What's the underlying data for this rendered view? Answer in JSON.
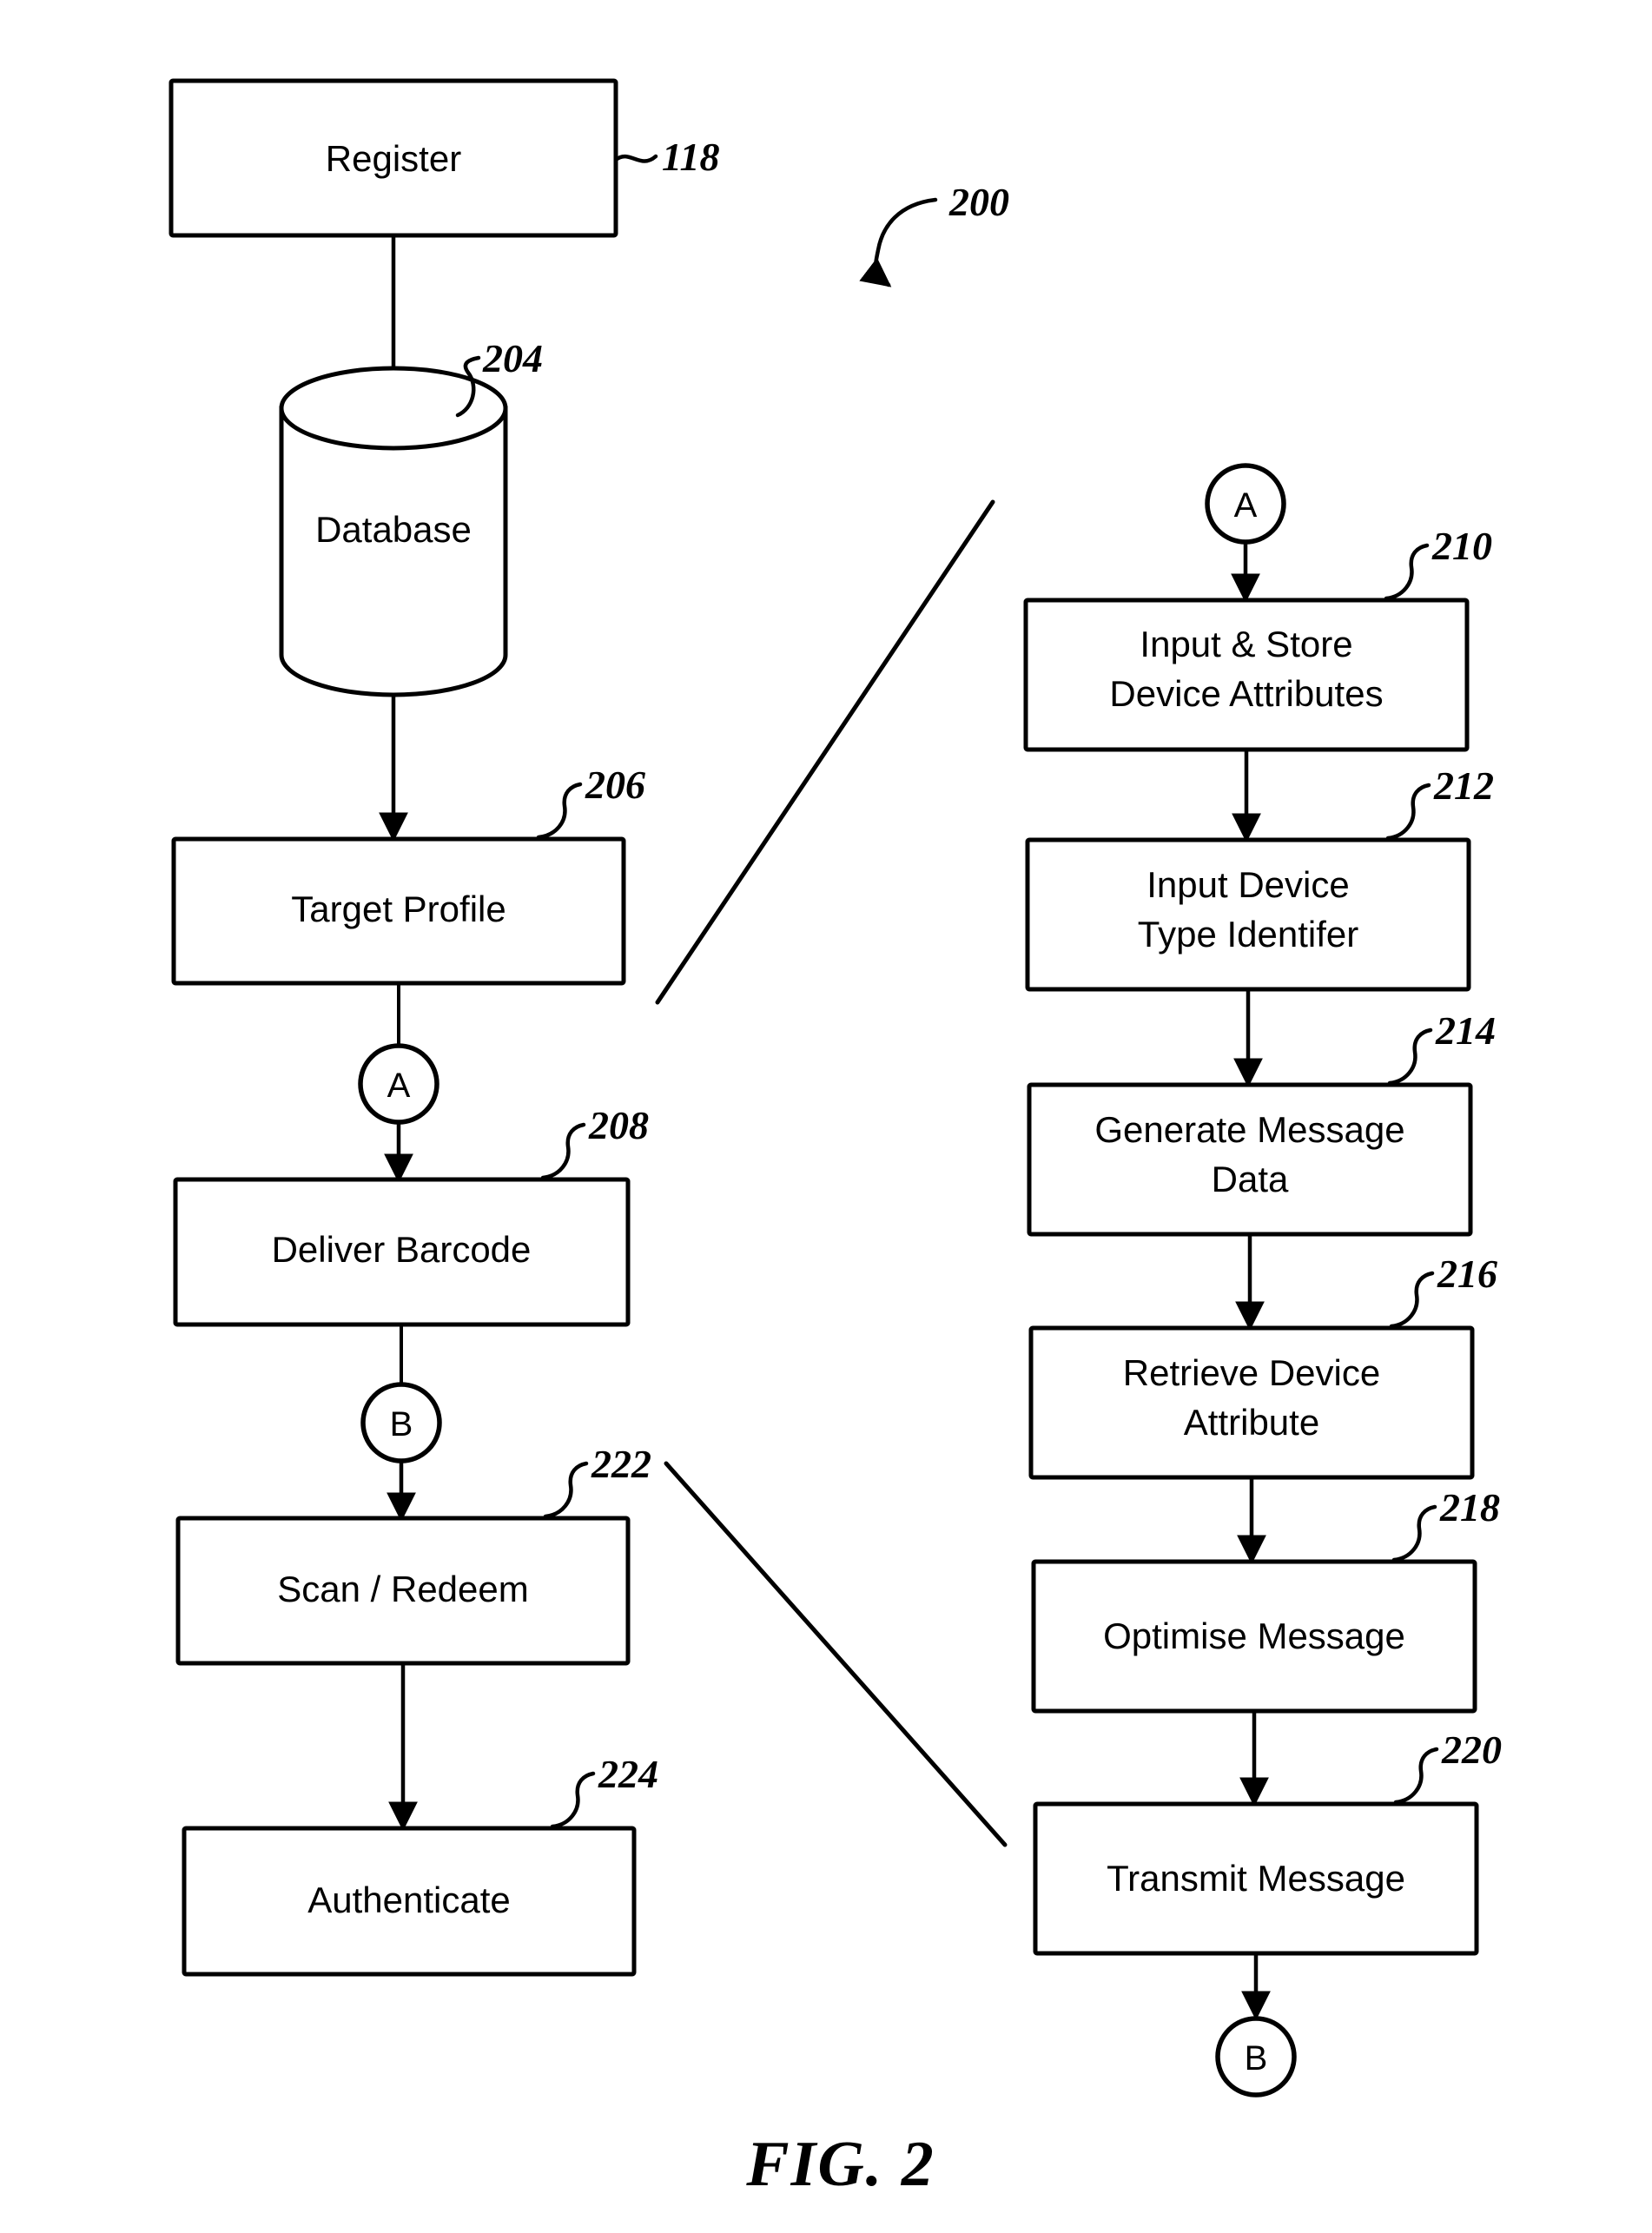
{
  "figure": {
    "caption": "FIG. 2",
    "overall_ref": "200"
  },
  "left_column": {
    "nodes": [
      {
        "id": "register",
        "label": "Register",
        "ref": "118",
        "shape": "rect"
      },
      {
        "id": "database",
        "label": "Database",
        "ref": "204",
        "shape": "cylinder"
      },
      {
        "id": "target_profile",
        "label": "Target Profile",
        "ref": "206",
        "shape": "rect"
      },
      {
        "id": "deliver_barcode",
        "label": "Deliver Barcode",
        "ref": "208",
        "shape": "rect"
      },
      {
        "id": "scan_redeem",
        "label": "Scan / Redeem",
        "ref": "222",
        "shape": "rect"
      },
      {
        "id": "authenticate",
        "label": "Authenticate",
        "ref": "224",
        "shape": "rect"
      }
    ],
    "connectors": [
      {
        "id": "conn_a_out",
        "label": "A"
      },
      {
        "id": "conn_b_out",
        "label": "B"
      }
    ]
  },
  "right_column": {
    "connector_in": {
      "id": "conn_a_in",
      "label": "A"
    },
    "connector_out": {
      "id": "conn_b_in",
      "label": "B"
    },
    "nodes": [
      {
        "id": "input_store_attrs",
        "label_line1": "Input & Store",
        "label_line2": "Device Attributes",
        "ref": "210"
      },
      {
        "id": "input_type_id",
        "label_line1": "Input Device",
        "label_line2": "Type Identifer",
        "ref": "212"
      },
      {
        "id": "generate_message",
        "label_line1": "Generate Message",
        "label_line2": "Data",
        "ref": "214"
      },
      {
        "id": "retrieve_attr",
        "label_line1": "Retrieve Device",
        "label_line2": "Attribute",
        "ref": "216"
      },
      {
        "id": "optimise_message",
        "label_line1": "Optimise Message",
        "label_line2": "",
        "ref": "218"
      },
      {
        "id": "transmit_message",
        "label_line1": "Transmit Message",
        "label_line2": "",
        "ref": "220"
      }
    ]
  },
  "colors": {
    "ink": "#000000",
    "paper": "#ffffff"
  }
}
